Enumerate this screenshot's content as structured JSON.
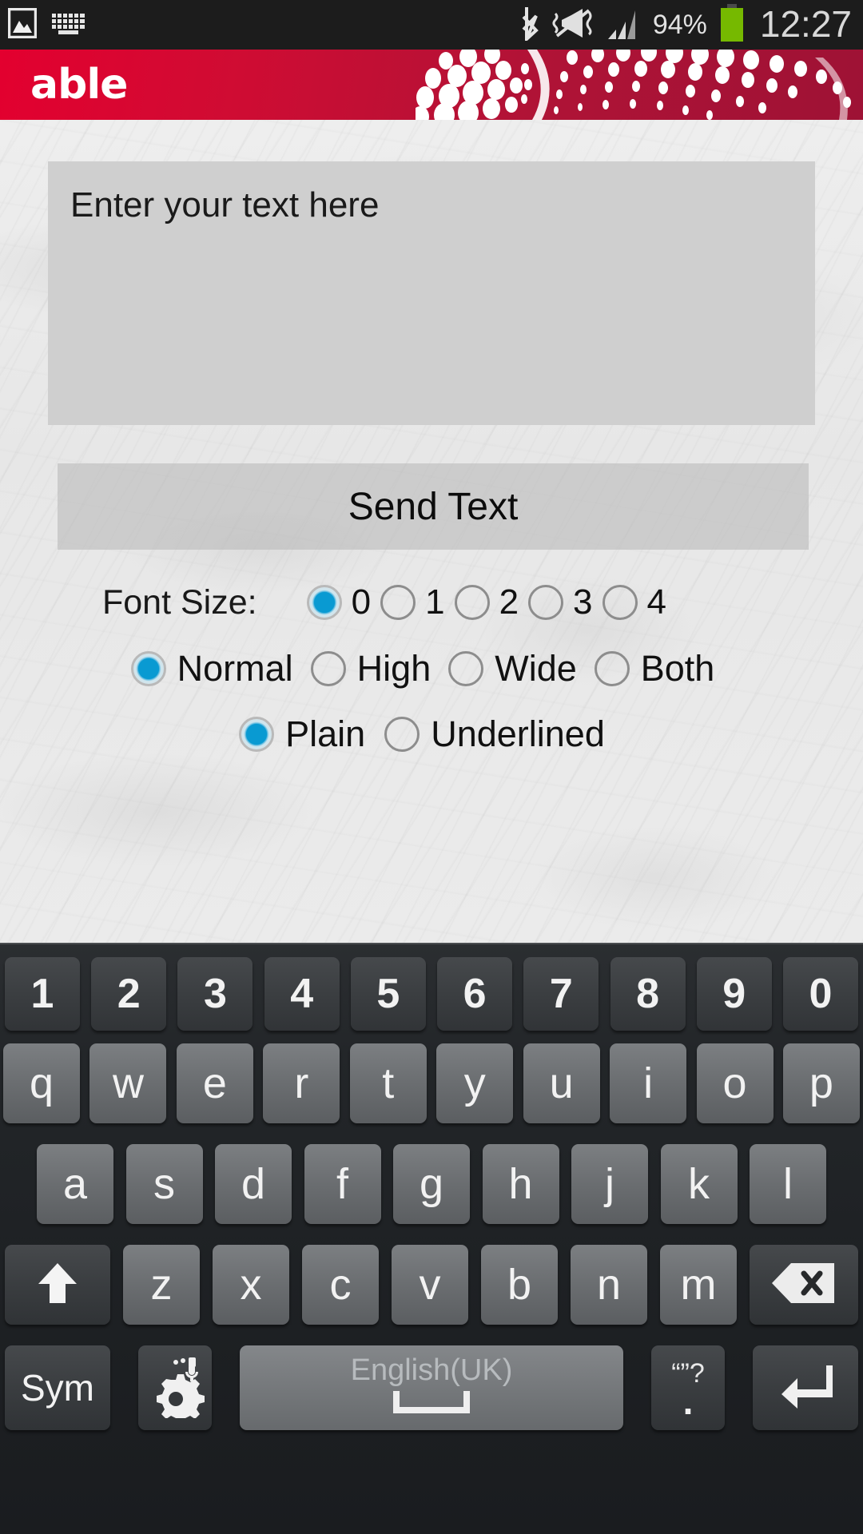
{
  "statusbar": {
    "left_icons": [
      "screenshot-image-icon",
      "keyboard-icon"
    ],
    "right_icons": [
      "bluetooth-icon",
      "sound-mute-vibrate-icon",
      "signal-bars-icon",
      "battery-icon"
    ],
    "battery_percent": "94%",
    "clock": "12:27"
  },
  "appheader": {
    "logo": "able",
    "brand_color": "#ce0e33",
    "pattern": "halftone-dots-pattern"
  },
  "form": {
    "text_input_placeholder": "Enter your text here",
    "text_input_value": "",
    "send_button_label": "Send Text",
    "font_size": {
      "label": "Font Size:",
      "options": [
        "0",
        "1",
        "2",
        "3",
        "4"
      ],
      "selected": "0"
    },
    "style": {
      "options": [
        "Normal",
        "High",
        "Wide",
        "Both"
      ],
      "selected": "Normal"
    },
    "decoration": {
      "options": [
        "Plain",
        "Underlined"
      ],
      "selected": "Plain"
    },
    "accent_color": "#099ad2"
  },
  "keyboard": {
    "row_numbers": [
      "1",
      "2",
      "3",
      "4",
      "5",
      "6",
      "7",
      "8",
      "9",
      "0"
    ],
    "row_top": [
      "q",
      "w",
      "e",
      "r",
      "t",
      "y",
      "u",
      "i",
      "o",
      "p"
    ],
    "row_home": [
      "a",
      "s",
      "d",
      "f",
      "g",
      "h",
      "j",
      "k",
      "l"
    ],
    "row_bottom": [
      "z",
      "x",
      "c",
      "v",
      "b",
      "n",
      "m"
    ],
    "shift_icon": "shift-up-arrow-icon",
    "backspace_icon": "backspace-delete-icon",
    "sym_label": "Sym",
    "settings_icon": "gear-microphone-icon",
    "space_label": "English(UK)",
    "space_icon": "spacebar-icon",
    "period_key_secondary": "“”?",
    "period_key_label": ".",
    "enter_icon": "enter-return-arrow-icon"
  }
}
